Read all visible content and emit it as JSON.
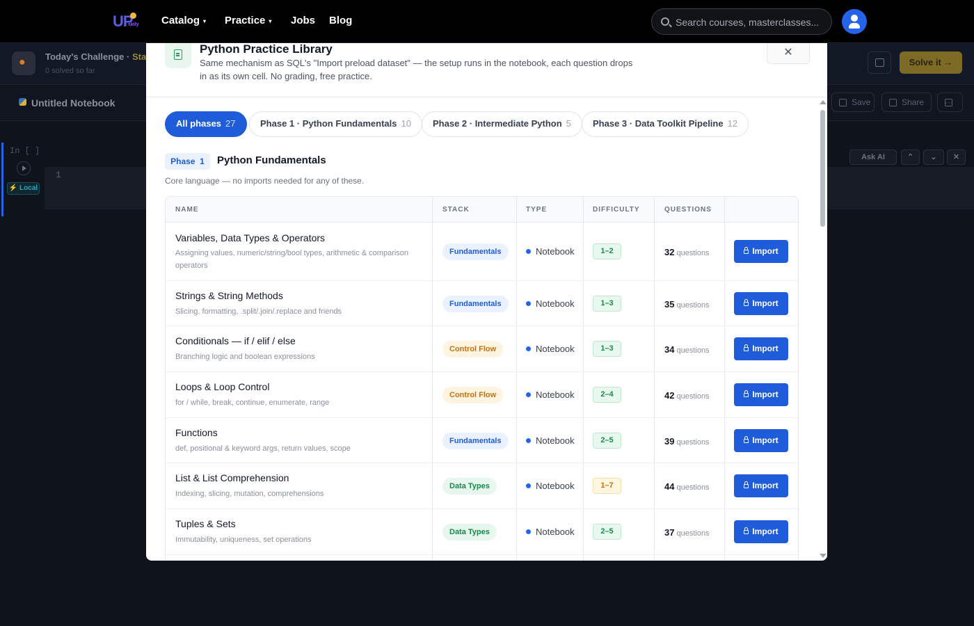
{
  "nav": {
    "logo_text": "UP",
    "logo_sub": "skily",
    "items": [
      {
        "label": "Catalog",
        "caret": "▾"
      },
      {
        "label": "Practice",
        "caret": "▾"
      },
      {
        "label": "Jobs"
      },
      {
        "label": "Blog"
      }
    ],
    "search_placeholder": "Search courses, masterclasses...",
    "avatar_icon": "user-icon"
  },
  "background": {
    "challenge_title": "Today's Challenge · ",
    "challenge_title_highlight": "Stat",
    "challenge_sub": "0 solved so far",
    "solve_label": "Solve it →",
    "notebook_title": "Untitled Notebook",
    "save_label": "Save",
    "share_label": "Share",
    "more_label": "···",
    "cell_in_label": "In [ ]",
    "local_label": "⚡ Local",
    "line_number": "1",
    "ask_ai_label": "Ask AI"
  },
  "modal": {
    "title": "Python Practice Library",
    "description": "Same mechanism as SQL's \"Import preload dataset\" — the setup runs in the notebook, each question drops in as its own cell. No grading, free practice.",
    "close_label": "✕",
    "pills": [
      {
        "label": "All phases",
        "count": "27",
        "active": true
      },
      {
        "label": "Phase 1 · Python Fundamentals",
        "count": "10"
      },
      {
        "label": "Phase 2 · Intermediate Python",
        "count": "5"
      },
      {
        "label": "Phase 3 · Data Toolkit Pipeline",
        "count": "12"
      }
    ],
    "phase": {
      "badge_label": "Phase",
      "badge_num": "1",
      "heading": "Python Fundamentals",
      "subtitle": "Core language — no imports needed for any of these."
    },
    "columns": [
      "NAME",
      "STACK",
      "TYPE",
      "DIFFICULTY",
      "QUESTIONS"
    ],
    "rows": [
      {
        "name": "Variables, Data Types & Operators",
        "desc": "Assigning values, numeric/string/bool types, arithmetic & comparison operators",
        "stack": "Fundamentals",
        "type": "Notebook",
        "difficulty": "1–2",
        "questions": "32",
        "q_label": "questions",
        "import": "Import"
      },
      {
        "name": "Strings & String Methods",
        "desc": "Slicing, formatting, .split/.join/.replace and friends",
        "stack": "Fundamentals",
        "type": "Notebook",
        "difficulty": "1–3",
        "questions": "35",
        "q_label": "questions",
        "import": "Import"
      },
      {
        "name": "Conditionals — if / elif / else",
        "desc": "Branching logic and boolean expressions",
        "stack": "Control Flow",
        "type": "Notebook",
        "difficulty": "1–3",
        "questions": "34",
        "q_label": "questions",
        "import": "Import"
      },
      {
        "name": "Loops & Loop Control",
        "desc": "for / while, break, continue, enumerate, range",
        "stack": "Control Flow",
        "type": "Notebook",
        "difficulty": "2–4",
        "questions": "42",
        "q_label": "questions",
        "import": "Import"
      },
      {
        "name": "Functions",
        "desc": "def, positional & keyword args, return values, scope",
        "stack": "Fundamentals",
        "type": "Notebook",
        "difficulty": "2–5",
        "questions": "39",
        "q_label": "questions",
        "import": "Import"
      },
      {
        "name": "List & List Comprehension",
        "desc": "Indexing, slicing, mutation, comprehensions",
        "stack": "Data Types",
        "type": "Notebook",
        "difficulty": "1–7",
        "questions": "44",
        "q_label": "questions",
        "import": "Import"
      },
      {
        "name": "Tuples & Sets",
        "desc": "Immutability, uniqueness, set operations",
        "stack": "Data Types",
        "type": "Notebook",
        "difficulty": "2–5",
        "questions": "37",
        "q_label": "questions",
        "import": "Import"
      }
    ]
  },
  "colors": {
    "accent": "#1f5cd9",
    "fundamentals_bg": "#eaf2ff",
    "fundamentals_fg": "#1f5cd9",
    "control_bg": "#fff4e0",
    "control_fg": "#c2710c",
    "datatypes_bg": "#e7f7ee",
    "datatypes_fg": "#178a4a",
    "diff_green_bg": "#e9f8ef",
    "diff_green_fg": "#178a4a",
    "diff_amber_bg": "#fff6e0",
    "diff_amber_fg": "#c2710c"
  }
}
